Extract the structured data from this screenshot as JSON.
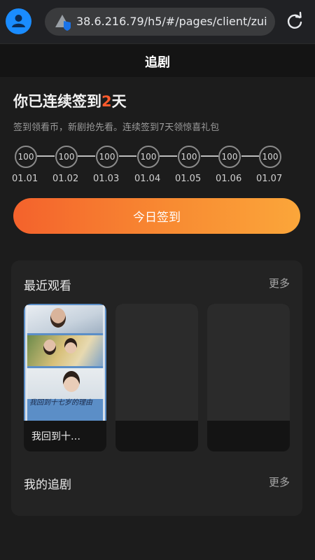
{
  "browser": {
    "url": "38.6.216.79/h5/#/pages/client/zui"
  },
  "header": {
    "title": "追剧"
  },
  "checkin": {
    "streak_prefix": "你已连续签到",
    "streak_days": "2",
    "streak_suffix": "天",
    "subtitle": "签到领看币，新剧抢先看。连续签到7天领惊喜礼包",
    "days": [
      {
        "coins": "100",
        "date": "01.01"
      },
      {
        "coins": "100",
        "date": "01.02"
      },
      {
        "coins": "100",
        "date": "01.03"
      },
      {
        "coins": "100",
        "date": "01.04"
      },
      {
        "coins": "100",
        "date": "01.05"
      },
      {
        "coins": "100",
        "date": "01.06"
      },
      {
        "coins": "100",
        "date": "01.07"
      }
    ],
    "button_label": "今日签到"
  },
  "recent": {
    "title": "最近观看",
    "more": "更多",
    "items": [
      {
        "title": "我回到十…",
        "poster_text": "我回到十七岁的理由"
      },
      {
        "title": ""
      },
      {
        "title": ""
      }
    ]
  },
  "following": {
    "title": "我的追剧",
    "more": "更多"
  },
  "colors": {
    "accent": "#ff5a2c",
    "button_gradient_start": "#f4622c",
    "button_gradient_end": "#fba63a",
    "avatar": "#1a8cff"
  }
}
